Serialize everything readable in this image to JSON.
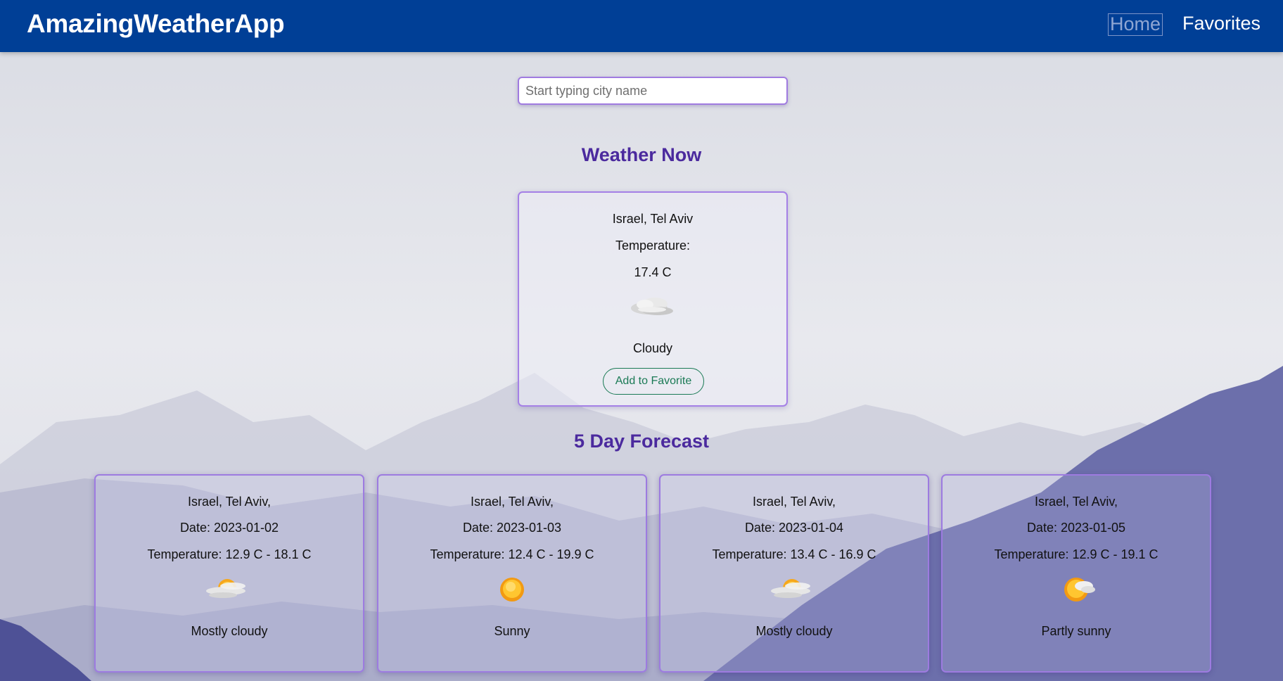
{
  "app": {
    "title": "AmazingWeatherApp"
  },
  "nav": {
    "home_label": "Home",
    "favorites_label": "Favorites"
  },
  "search": {
    "placeholder": "Start typing city name",
    "value": ""
  },
  "current": {
    "section_title": "Weather Now",
    "location": "Israel, Tel Aviv",
    "temperature_label": "Temperature:",
    "temperature_value": "17.4 C",
    "icon": "cloud-icon",
    "description": "Cloudy",
    "favorite_button_label": "Add to Favorite"
  },
  "forecast": {
    "section_title": "5 Day Forecast",
    "days": [
      {
        "location": "Israel, Tel Aviv,",
        "date": "Date: 2023-01-02",
        "temperature": "Temperature: 12.9 C - 18.1 C",
        "icon": "mostly-cloudy-icon",
        "description": "Mostly cloudy"
      },
      {
        "location": "Israel, Tel Aviv,",
        "date": "Date: 2023-01-03",
        "temperature": "Temperature: 12.4 C - 19.9 C",
        "icon": "sun-icon",
        "description": "Sunny"
      },
      {
        "location": "Israel, Tel Aviv,",
        "date": "Date: 2023-01-04",
        "temperature": "Temperature: 13.4 C - 16.9 C",
        "icon": "mostly-cloudy-icon",
        "description": "Mostly cloudy"
      },
      {
        "location": "Israel, Tel Aviv,",
        "date": "Date: 2023-01-05",
        "temperature": "Temperature: 12.9 C - 19.1 C",
        "icon": "partly-sunny-icon",
        "description": "Partly sunny"
      }
    ]
  },
  "colors": {
    "navbar": "#003f96",
    "heading": "#4b2a9e",
    "card_border": "#a580e6",
    "favorite_button": "#1a7a55"
  }
}
